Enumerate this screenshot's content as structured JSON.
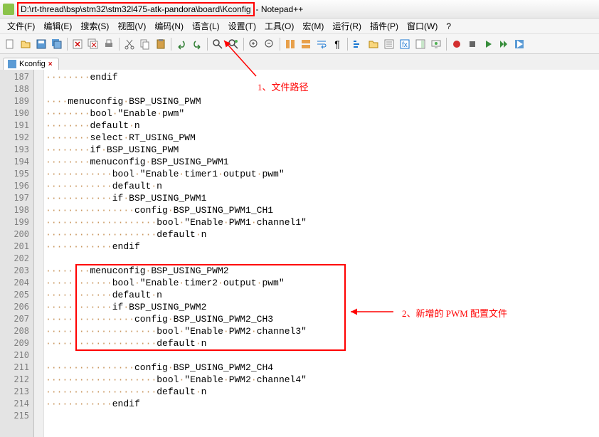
{
  "title": {
    "path": "D:\\rt-thread\\bsp\\stm32\\stm32l475-atk-pandora\\board\\Kconfig",
    "app": " - Notepad++"
  },
  "menu": {
    "file": "文件(F)",
    "edit": "编辑(E)",
    "search": "搜索(S)",
    "view": "视图(V)",
    "encoding": "编码(N)",
    "language": "语言(L)",
    "settings": "设置(T)",
    "tools": "工具(O)",
    "macro": "宏(M)",
    "run": "运行(R)",
    "plugins": "插件(P)",
    "window": "窗口(W)",
    "help": "?"
  },
  "tab": {
    "name": "Kconfig"
  },
  "lines": [
    {
      "num": "187",
      "text": "········endif"
    },
    {
      "num": "188",
      "text": ""
    },
    {
      "num": "189",
      "text": "····menuconfig·BSP_USING_PWM"
    },
    {
      "num": "190",
      "text": "········bool·\"Enable·pwm\""
    },
    {
      "num": "191",
      "text": "········default·n"
    },
    {
      "num": "192",
      "text": "········select·RT_USING_PWM"
    },
    {
      "num": "193",
      "text": "········if·BSP_USING_PWM"
    },
    {
      "num": "194",
      "text": "········menuconfig·BSP_USING_PWM1"
    },
    {
      "num": "195",
      "text": "············bool·\"Enable·timer1·output·pwm\""
    },
    {
      "num": "196",
      "text": "············default·n"
    },
    {
      "num": "197",
      "text": "············if·BSP_USING_PWM1"
    },
    {
      "num": "198",
      "text": "················config·BSP_USING_PWM1_CH1"
    },
    {
      "num": "199",
      "text": "····················bool·\"Enable·PWM1·channel1\""
    },
    {
      "num": "200",
      "text": "····················default·n"
    },
    {
      "num": "201",
      "text": "············endif"
    },
    {
      "num": "202",
      "text": ""
    },
    {
      "num": "203",
      "text": "········menuconfig·BSP_USING_PWM2"
    },
    {
      "num": "204",
      "text": "············bool·\"Enable·timer2·output·pwm\""
    },
    {
      "num": "205",
      "text": "············default·n"
    },
    {
      "num": "206",
      "text": "············if·BSP_USING_PWM2"
    },
    {
      "num": "207",
      "text": "················config·BSP_USING_PWM2_CH3"
    },
    {
      "num": "208",
      "text": "····················bool·\"Enable·PWM2·channel3\""
    },
    {
      "num": "209",
      "text": "····················default·n"
    },
    {
      "num": "210",
      "text": ""
    },
    {
      "num": "211",
      "text": "················config·BSP_USING_PWM2_CH4"
    },
    {
      "num": "212",
      "text": "····················bool·\"Enable·PWM2·channel4\""
    },
    {
      "num": "213",
      "text": "····················default·n"
    },
    {
      "num": "214",
      "text": "············endif"
    },
    {
      "num": "215",
      "text": ""
    }
  ],
  "annotations": {
    "a1": "1、文件路径",
    "a2": "2、新增的 PWM 配置文件"
  }
}
